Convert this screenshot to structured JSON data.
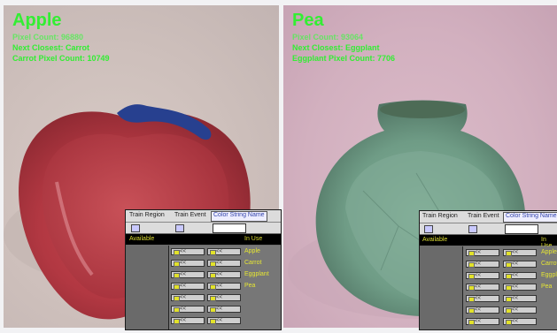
{
  "left": {
    "title": "Apple",
    "pixel_count_label": "Pixel Count: 96880",
    "next_closest": "Next Closest: Carrot",
    "next_pixel_count": "Carrot Pixel Count: 10749"
  },
  "right": {
    "title": "Pea",
    "pixel_count_label": "Pixel Count: 93064",
    "next_closest": "Next Closest: Eggplant",
    "next_pixel_count": "Eggplant Pixel Count: 7706"
  },
  "panel": {
    "tab_train_region": "Train Region",
    "tab_train_event": "Train Event",
    "tab_color_string_name": "Color String Name",
    "header_available": "Available",
    "header_in_use": "In Use",
    "button_label": "<<",
    "in_use_items": [
      "Apple",
      "Carrot",
      "Eggplant",
      "Pea"
    ]
  },
  "colors": {
    "overlay_text": "#33ee33",
    "header_text": "#dddd33",
    "apple_red": "#b53a44",
    "stem_blue": "#27408f",
    "pea_green": "#6f9c86"
  }
}
